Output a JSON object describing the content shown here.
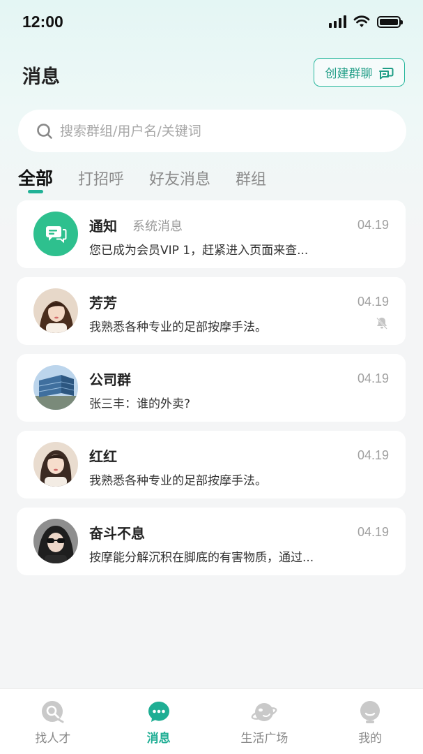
{
  "status_bar": {
    "time": "12:00"
  },
  "header": {
    "title": "消息",
    "create_group_label": "创建群聊"
  },
  "search": {
    "placeholder": "搜索群组/用户名/关键词"
  },
  "tabs": [
    {
      "label": "全部",
      "active": true
    },
    {
      "label": "打招呼",
      "active": false
    },
    {
      "label": "好友消息",
      "active": false
    },
    {
      "label": "群组",
      "active": false
    }
  ],
  "messages": [
    {
      "name": "通知",
      "subtitle": "系统消息",
      "preview": "您已成为会员VIP 1，赶紧进入页面来查...",
      "time": "04.19",
      "avatar": "notification-icon",
      "muted": false
    },
    {
      "name": "芳芳",
      "subtitle": "",
      "preview": "我熟悉各种专业的足部按摩手法。",
      "time": "04.19",
      "avatar": "user-photo",
      "muted": true
    },
    {
      "name": "公司群",
      "subtitle": "",
      "preview": "张三丰：谁的外卖?",
      "time": "04.19",
      "avatar": "group-photo",
      "muted": false
    },
    {
      "name": "红红",
      "subtitle": "",
      "preview": "我熟悉各种专业的足部按摩手法。",
      "time": "04.19",
      "avatar": "user-photo",
      "muted": false
    },
    {
      "name": "奋斗不息",
      "subtitle": "",
      "preview": "按摩能分解沉积在脚底的有害物质，通过...",
      "time": "04.19",
      "avatar": "user-photo",
      "muted": false
    }
  ],
  "bottom_nav": [
    {
      "label": "找人才",
      "icon": "search-talent-icon",
      "active": false
    },
    {
      "label": "消息",
      "icon": "chat-bubble-icon",
      "active": true
    },
    {
      "label": "生活广场",
      "icon": "planet-icon",
      "active": false
    },
    {
      "label": "我的",
      "icon": "profile-icon",
      "active": false
    }
  ],
  "colors": {
    "accent": "#21b196",
    "accent_text": "#1f9d86",
    "muted_text": "#a0a0a0",
    "inactive_icon": "#c8c8c8"
  }
}
